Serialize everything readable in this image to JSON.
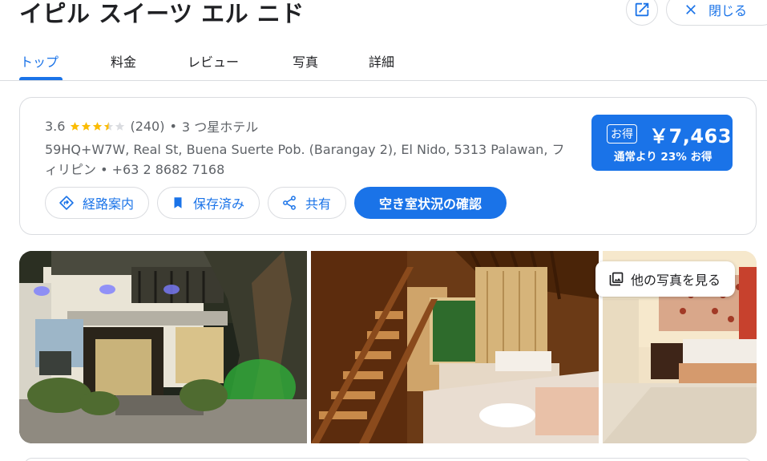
{
  "hotel": {
    "name": "イピル スイーツ エル ニド"
  },
  "header": {
    "close_label": "閉じる"
  },
  "tabs": [
    {
      "label": "トップ"
    },
    {
      "label": "料金"
    },
    {
      "label": "レビュー"
    },
    {
      "label": "写真"
    },
    {
      "label": "詳細"
    }
  ],
  "rating": {
    "score": "3.6",
    "stars": 3.5,
    "count": "(240)",
    "sep": "•",
    "category": "3 つ星ホテル"
  },
  "address": "59HQ+W7W, Real St, Buena Suerte Pob. (Barangay 2), El Nido, 5313 Palawan, フィリピン • +63 2 8682 7168",
  "price": {
    "badge": "お得",
    "amount": "￥7,463",
    "saving": "通常より 23% お得"
  },
  "actions": {
    "directions": "経路案内",
    "saved": "保存済み",
    "share": "共有",
    "availability": "空き室状況の確認"
  },
  "photos": {
    "more_label": "他の写真を見る"
  },
  "colors": {
    "accent": "#1a73e8",
    "star": "#fbbc04",
    "text_secondary": "#5f6368",
    "border": "#dadce0"
  },
  "icons": [
    "open-external-icon",
    "close-icon",
    "star-icon",
    "directions-icon",
    "bookmark-icon",
    "share-icon",
    "photo-library-icon"
  ]
}
